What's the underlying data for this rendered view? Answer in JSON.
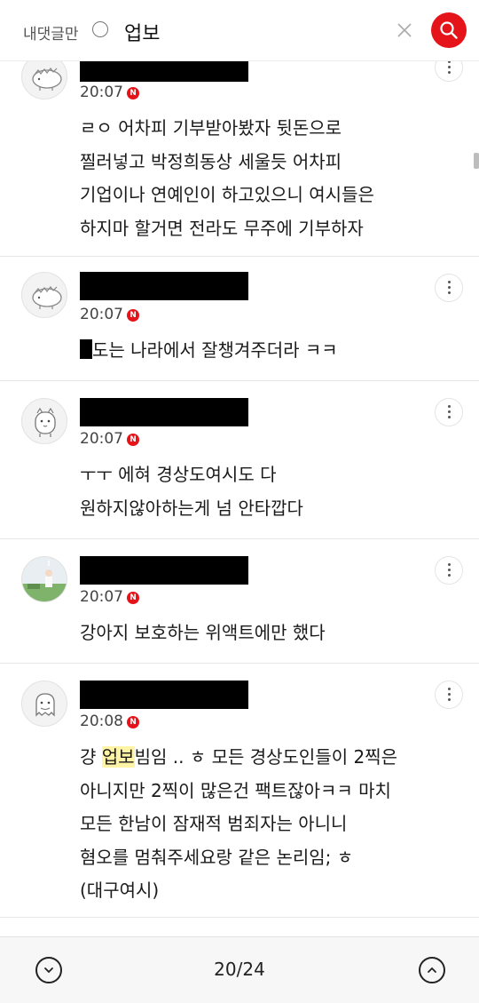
{
  "search": {
    "mine_only_label": "내댓글만",
    "query": "업보"
  },
  "comments": [
    {
      "time": "20:07",
      "new_badge": "N",
      "avatar_icon": "hedgehog-avatar-icon",
      "lines": [
        "ㄹㅇ 어차피 기부받아봤자 뒷돈으로",
        "찔러넣고 박정희동상 세울듯 어차피",
        "기업이나 연예인이 하고있으니 여시들은",
        "하지마 할거면 전라도 무주에 기부하자"
      ]
    },
    {
      "time": "20:07",
      "new_badge": "N",
      "avatar_icon": "hedgehog-avatar-icon",
      "text_after_redaction": "도는 나라에서 잘챙겨주더라 ㅋㅋ"
    },
    {
      "time": "20:07",
      "new_badge": "N",
      "avatar_icon": "cat-avatar-icon",
      "lines": [
        "ㅜㅜ 에혀 경상도여시도 다",
        "원하지않아하는게 넘 안타깝다"
      ]
    },
    {
      "time": "20:07",
      "new_badge": "N",
      "avatar_icon": "photo-avatar-icon",
      "lines": [
        "강아지 보호하는 위액트에만 했다"
      ]
    },
    {
      "time": "20:08",
      "new_badge": "N",
      "avatar_icon": "ghost-avatar-icon",
      "first_line_prefix": "걍 ",
      "first_line_highlight": "업보",
      "first_line_suffix": "빔임 .. ㅎ 모든 경상도인들이 2찍은",
      "lines": [
        "아니지만 2찍이 많은건 팩트잖아ㅋㅋ 마치",
        "모든 한남이 잠재적 범죄자는 아니니",
        "혐오를 멈춰주세요랑 같은 논리임; ㅎ",
        "(대구여시)"
      ]
    }
  ],
  "pager": {
    "current": "20/24"
  },
  "colors": {
    "accent": "#e5141b",
    "highlight": "#fff4a6"
  }
}
